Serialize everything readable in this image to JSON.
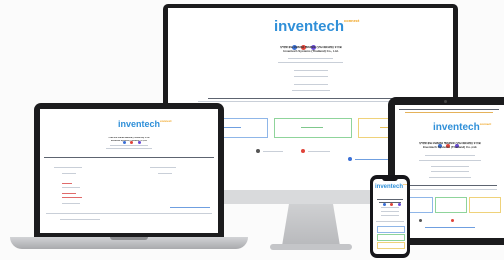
{
  "imac": {
    "logo": "inventech",
    "logo_tag": "connect",
    "company_th": "บริษัท อินเวนท์เทค ซิสเท็มส์ (ประเทศไทย) จำกัด",
    "company_en": "Inventech Systems (Thailand) Co., Ltd."
  },
  "macbook": {
    "logo": "inventech",
    "logo_tag": "connect",
    "company_th": "บริษัท อินเวนท์เทค ซิสเท็มส์ (ประเทศไทย) จำกัด",
    "company_en": "Inventech Systems (Thailand) Co.,Ltd."
  },
  "ipad": {
    "logo": "inventech",
    "logo_tag": "connect",
    "company_th": "บริษัท อินเวนท์เทค ซิสเท็มส์ (ประเทศไทย) จำกัด",
    "company_en": "Inventech Systems (Thailand) Co.,Ltd."
  },
  "iphone": {
    "logo": "inventech",
    "logo_tag": "connect"
  },
  "colors": {
    "brand_blue": "#2f8fd8",
    "brand_orange": "#f0a21b",
    "device_dark": "#1b1b1d",
    "silver": "#d9dadc"
  }
}
